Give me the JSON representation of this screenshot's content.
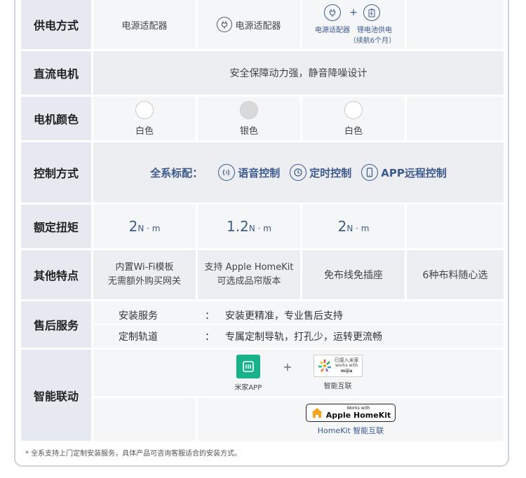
{
  "power": {
    "label": "供电方式",
    "c1": "电源适配器",
    "c2": "电源适配器",
    "c3_a": "电源适配器",
    "c3_plus": "+",
    "c3_b": "锂电池供电",
    "c3_b2": "（续航6个月）"
  },
  "motor": {
    "label": "直流电机",
    "text": "安全保障动力强，静音降噪设计"
  },
  "color": {
    "label": "电机颜色",
    "items": [
      {
        "name": "白色",
        "hex": "#ffffff"
      },
      {
        "name": "银色",
        "hex": "#d9d9d9"
      },
      {
        "name": "白色",
        "hex": "#ffffff"
      }
    ]
  },
  "control": {
    "label": "控制方式",
    "prefix": "全系标配：",
    "voice": "语音控制",
    "timer": "定时控制",
    "app": "APP远程控制"
  },
  "torque": {
    "label": "额定扭矩",
    "items": [
      {
        "num": "2",
        "unit": "N · m"
      },
      {
        "num": "1.2",
        "unit": "N · m"
      },
      {
        "num": "2",
        "unit": "N · m"
      }
    ]
  },
  "features": {
    "label": "其他特点",
    "c1_l1": "内置Wi-Fi模板",
    "c1_l2": "无需额外购买网关",
    "c2_l1": "支持 Apple HomeKit",
    "c2_l2": "可选成品帘版本",
    "c3": "免布线免插座",
    "c4": "6种布料随心选"
  },
  "service": {
    "label": "售后服务",
    "rows": [
      {
        "k": "安装服务",
        "colon": "：",
        "v": "安装更精准，专业售后支持"
      },
      {
        "k": "定制轨道",
        "colon": "：",
        "v": "专属定制导轨，打孔少，运转更流畅"
      }
    ]
  },
  "smart": {
    "label": "智能联动",
    "mijia_app": "米家APP",
    "plus": "+",
    "mijia_badge_1": "已接入米家",
    "mijia_badge_2": "works with",
    "mijia_badge_3": "mijia",
    "mijia_link": "智能互联",
    "hk_small": "Works with",
    "hk_big": "Apple HomeKit",
    "hk_link": "HomeKit 智能互联"
  },
  "note": "* 全系支持上门定制安装服务，具体产品可咨询客服适合的安装方式。",
  "colors": {
    "accent": "#3d5a8c",
    "label_bg": "#e6e9ef",
    "cell_bg": "#f5f6f8",
    "mijia_green": "#17b18a"
  }
}
